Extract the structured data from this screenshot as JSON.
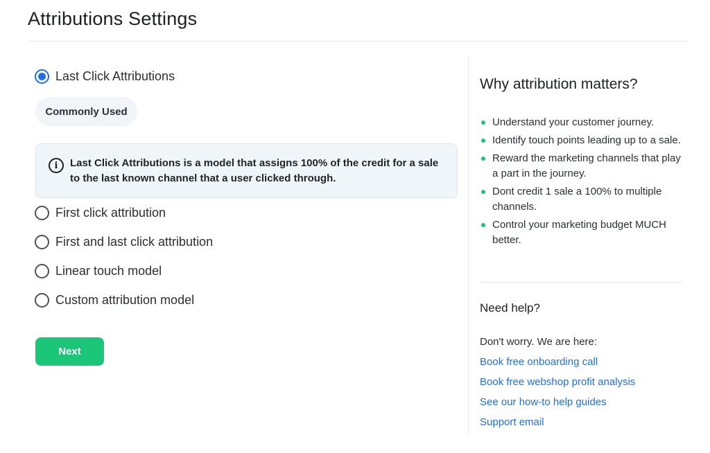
{
  "header": {
    "title": "Attributions Settings"
  },
  "options": [
    {
      "label": "Last Click Attributions",
      "checked": true
    },
    {
      "label": "First click attribution",
      "checked": false
    },
    {
      "label": "First and last click attribution",
      "checked": false
    },
    {
      "label": "Linear touch model",
      "checked": false
    },
    {
      "label": "Custom attribution model",
      "checked": false
    }
  ],
  "chip": {
    "label": "Commonly Used"
  },
  "info": {
    "text": "Last Click Attributions is a model that assigns 100% of the credit for a sale to the last known channel that a user clicked through."
  },
  "actions": {
    "next_label": "Next"
  },
  "sidebar": {
    "heading": "Why attribution matters?",
    "bullets": [
      "Understand your customer journey.",
      "Identify touch points leading up to a sale.",
      "Reward the marketing channels that play a part in the journey.",
      "Dont credit 1 sale a 100% to multiple channels.",
      "Control your marketing budget MUCH better."
    ],
    "help_heading": "Need help?",
    "help_sub": "Don't worry. We are here:",
    "links": [
      "Book free onboarding call",
      "Book free webshop profit analysis",
      "See our how-to help guides",
      "Support email"
    ]
  },
  "colors": {
    "accent": "#1f6fe5",
    "success": "#1cc679",
    "info_bg": "#f0f5fa"
  },
  "icons": {
    "info": "info-circle-icon",
    "bullet": "bullet-dot-icon"
  }
}
